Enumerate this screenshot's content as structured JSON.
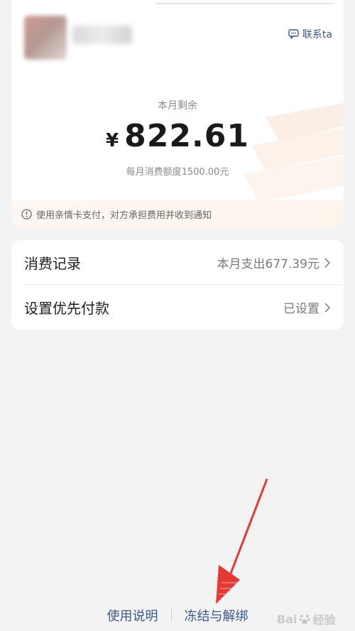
{
  "header": {
    "contact_label": "联系ta"
  },
  "balance": {
    "remain_label": "本月剩余",
    "currency_symbol": "¥",
    "amount": "822.61",
    "monthly_limit_text": "每月消费额度1500.00元"
  },
  "notice": {
    "text": "使用亲情卡支付，对方承担费用并收到通知"
  },
  "menu": {
    "items": [
      {
        "label": "消费记录",
        "value": "本月支出677.39元"
      },
      {
        "label": "设置优先付款",
        "value": "已设置"
      }
    ]
  },
  "footer": {
    "links": [
      {
        "label": "使用说明"
      },
      {
        "label": "冻结与解绑"
      }
    ]
  },
  "watermark": {
    "brand_left": "Bai",
    "brand_right": "经验"
  },
  "colors": {
    "link_blue": "#3b5a8c",
    "arrow_red": "#e53935",
    "notice_bg": "#fdf6ef"
  }
}
